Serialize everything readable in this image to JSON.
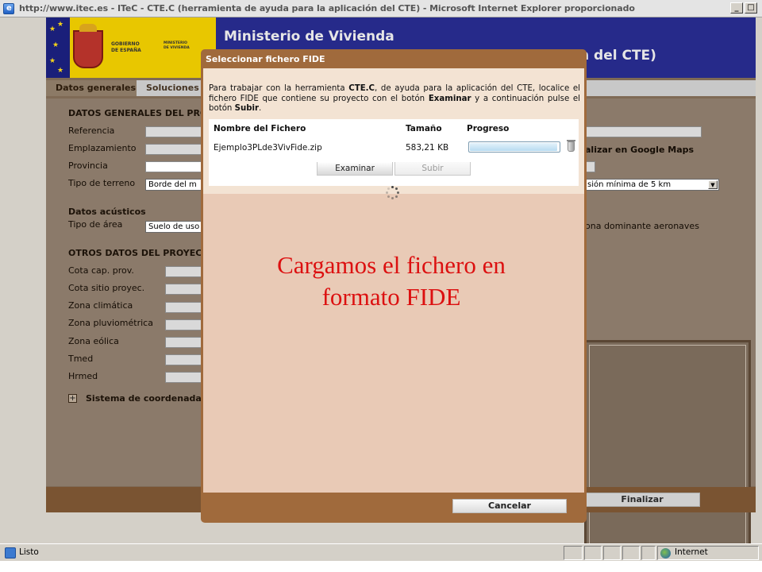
{
  "window": {
    "title": "http://www.itec.es - ITeC - CTE.C (herramienta de ayuda para la aplicación del CTE) - Microsoft Internet Explorer proporcionado"
  },
  "header": {
    "gov_line1": "GOBIERNO",
    "gov_line2": "DE ESPAÑA",
    "min_line1": "MINISTERIO",
    "min_line2": "DE VIVIENDA",
    "title": "Ministerio de Vivienda",
    "subtitle_fragment": "n del CTE)"
  },
  "tabs": [
    {
      "label": "Datos generales"
    },
    {
      "label": "Soluciones c"
    }
  ],
  "form": {
    "general_section": "DATOS GENERALES DEL PRO",
    "labels": {
      "referencia": "Referencia",
      "emplazamiento": "Emplazamiento",
      "provincia": "Provincia",
      "tipo_terreno": "Tipo de terreno"
    },
    "tipo_terreno_value": "Borde del m",
    "google_maps_fragment": "alizar en Google Maps",
    "terrain_right_value": "sión mínima de 5 km",
    "acoustic_section": "Datos acústicos",
    "tipo_area_label": "Tipo de área",
    "tipo_area_value": "Suelo de uso",
    "aircraft_fragment": "ona dominante aeronaves",
    "other_section": "OTROS DATOS DEL PROYECT",
    "other_labels": [
      {
        "label": "Cota cap. prov."
      },
      {
        "label": "Cota sitio proyec."
      },
      {
        "label": "Zona climática"
      },
      {
        "label": "Zona pluviométrica"
      },
      {
        "label": "Zona eólica"
      },
      {
        "label": "Tmed"
      },
      {
        "label": "Hrmed"
      }
    ],
    "coord_expander": "Sistema de coordenada",
    "finalize_label": "Finalizar"
  },
  "modal": {
    "title": "Seleccionar fichero FIDE",
    "info_text": {
      "p1": "Para trabajar con la herramienta ",
      "b1": "CTE.C",
      "p2": ", de ayuda para la aplicación del CTE, localice el fichero FIDE que contiene su proyecto con el botón ",
      "b2": "Examinar",
      "p3": " y a continuación pulse el botón ",
      "b3": "Subir",
      "p4": "."
    },
    "columns": {
      "name": "Nombre del Fichero",
      "size": "Tamaño",
      "progress": "Progreso"
    },
    "file": {
      "name": "Ejemplo3PLde3VivFide.zip",
      "size": "583,21 KB",
      "progress_fraction": 0.98
    },
    "browse_label": "Examinar",
    "upload_label": "Subir",
    "annotation": {
      "line1": "Cargamos el fichero en",
      "line2": "formato FIDE"
    },
    "cancel_label": "Cancelar"
  },
  "statusbar": {
    "status": "Listo",
    "zone": "Internet"
  }
}
